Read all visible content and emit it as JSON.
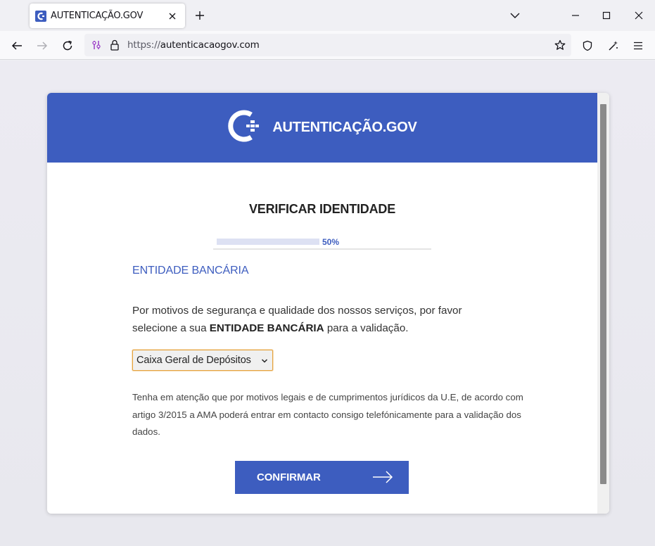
{
  "browser": {
    "tab_title": "AUTENTICAÇÃO.GOV",
    "url_scheme": "https://",
    "url_host": "autenticacaogov.com"
  },
  "page": {
    "brand_name": "AUTENTICAÇÃO.GOV",
    "heading": "VERIFICAR IDENTIDADE",
    "progress_label": "50%",
    "progress_fraction": 0.47,
    "section_title": "ENTIDADE BANCÁRIA",
    "para_part1": "Por motivos de segurança e qualidade dos nossos serviços, por favor selecione a sua ",
    "para_bold": "ENTIDADE BANCÁRIA",
    "para_part2": " para a validação.",
    "bank_select_value": "Caixa Geral de Depósitos",
    "note": "Tenha em atenção que por motivos legais e de cumprimentos jurídicos da U.E, de acordo com artigo 3/2015 a AMA poderá entrar em contacto consigo telefónicamente para a validação dos dados.",
    "confirm_label": "CONFIRMAR"
  },
  "colors": {
    "brand_blue": "#3d5dbf",
    "progress_track": "#dde1f3",
    "select_focus": "#e6a33e"
  },
  "icons": [
    "autenticacao-favicon",
    "close-icon",
    "plus-icon",
    "chevron-down-icon",
    "minimize-icon",
    "maximize-icon",
    "close-window-icon",
    "back-arrow-icon",
    "forward-arrow-icon",
    "reload-icon",
    "permissions-icon",
    "lock-icon",
    "star-icon",
    "shield-icon",
    "extensions-icon",
    "menu-icon",
    "brand-logo",
    "arrow-right-icon"
  ]
}
